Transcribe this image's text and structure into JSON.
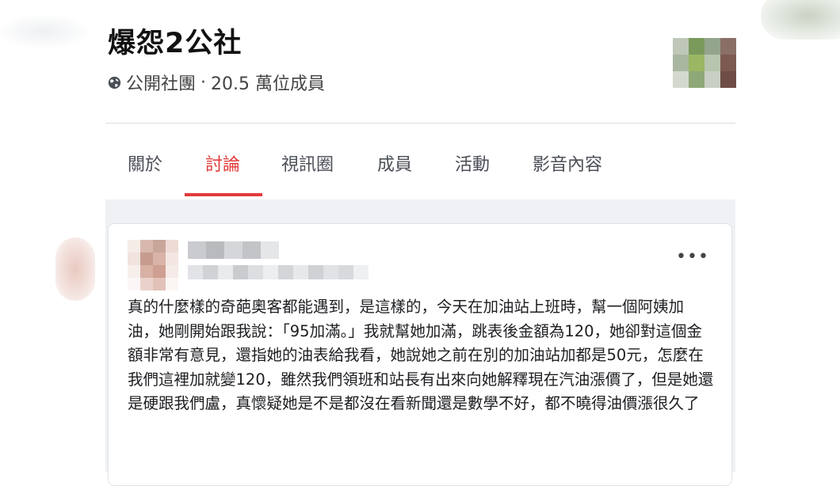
{
  "group": {
    "name": "爆怨2公社",
    "privacy_icon": "globe-icon",
    "privacy": "公開社團",
    "separator": "·",
    "member_count": "20.5 萬位成員"
  },
  "tabs": [
    {
      "label": "關於",
      "active": false
    },
    {
      "label": "討論",
      "active": true
    },
    {
      "label": "視訊圈",
      "active": false
    },
    {
      "label": "成員",
      "active": false
    },
    {
      "label": "活動",
      "active": false
    },
    {
      "label": "影音內容",
      "active": false
    }
  ],
  "colors": {
    "accent": "#e33b3b",
    "feed_background": "#eff1f4"
  },
  "post": {
    "more_label": "•••",
    "body": "真的什麼樣的奇葩奧客都能遇到，是這樣的，今天在加油站上班時，幫一個阿姨加油，她剛開始跟我說：「95加滿。」我就幫她加滿，跳表後金額為120，她卻對這個金額非常有意見，還指她的油表給我看，她說她之前在別的加油站加都是50元，怎麼在我們這裡加就變120，雖然我們領班和站長有出來向她解釋現在汽油漲價了，但是她還是硬跟我們盧，真懷疑她是不是都沒在看新聞還是數學不好，都不曉得油價漲很久了"
  }
}
